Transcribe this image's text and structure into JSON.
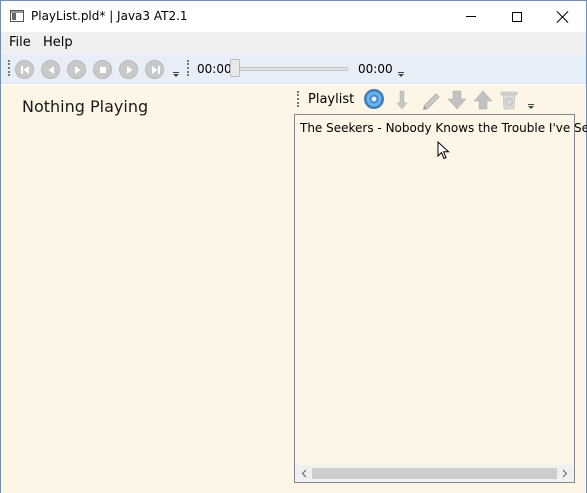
{
  "window": {
    "title": "PlayList.pld* | Java3 AT2.1",
    "icon": "app-window-icon",
    "controls": [
      "minimize-icon",
      "maximize-icon",
      "close-icon"
    ]
  },
  "menu": {
    "file": "File",
    "help": "Help"
  },
  "player": {
    "buttons": [
      "skip-back-icon",
      "previous-icon",
      "play-icon",
      "stop-icon",
      "next-icon",
      "skip-forward-icon"
    ],
    "time_elapsed": "00:00",
    "time_total": "00:00",
    "position_fraction": 0
  },
  "now_playing": {
    "text": "Nothing Playing"
  },
  "playlist": {
    "label": "Playlist",
    "toolbar_icons": [
      "disc-icon",
      "insert-icon",
      "edit-icon",
      "move-down-icon",
      "move-up-icon",
      "delete-icon"
    ],
    "items": [
      "The Seekers - Nobody Knows the Trouble I've Seen"
    ]
  },
  "colors": {
    "pane_background": "#fdf5e6",
    "toolbar_background": "#e7eef8"
  }
}
